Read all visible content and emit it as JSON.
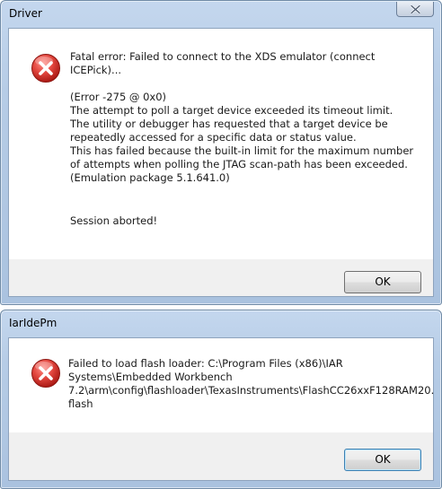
{
  "dialogs": [
    {
      "title": "Driver",
      "heading": "Fatal error: Failed to connect to the XDS emulator (connect ICEPick)...",
      "lines": [
        "(Error -275 @ 0x0)",
        "The attempt to poll a target device exceeded its timeout limit.",
        "The utility or debugger has requested that a target device be",
        "repeatedly accessed for a specific data or status value.",
        "This has failed because the built-in limit for the maximum number",
        "of attempts when polling the JTAG scan-path has been exceeded.",
        "(Emulation package 5.1.641.0)"
      ],
      "footer": "Session aborted!",
      "ok_label": "OK"
    },
    {
      "title": "IarIdePm",
      "lines": [
        "Failed to load flash loader: C:\\Program Files (x86)\\IAR",
        "Systems\\Embedded Workbench",
        "7.2\\arm\\config\\flashloader\\TexasInstruments\\FlashCC26xxF128RAM20.",
        "flash"
      ],
      "ok_label": "OK"
    }
  ],
  "icons": {
    "error": "error-icon",
    "close": "close-icon"
  },
  "colors": {
    "error_red": "#d4302c",
    "title_bar": "#b6cce6"
  }
}
